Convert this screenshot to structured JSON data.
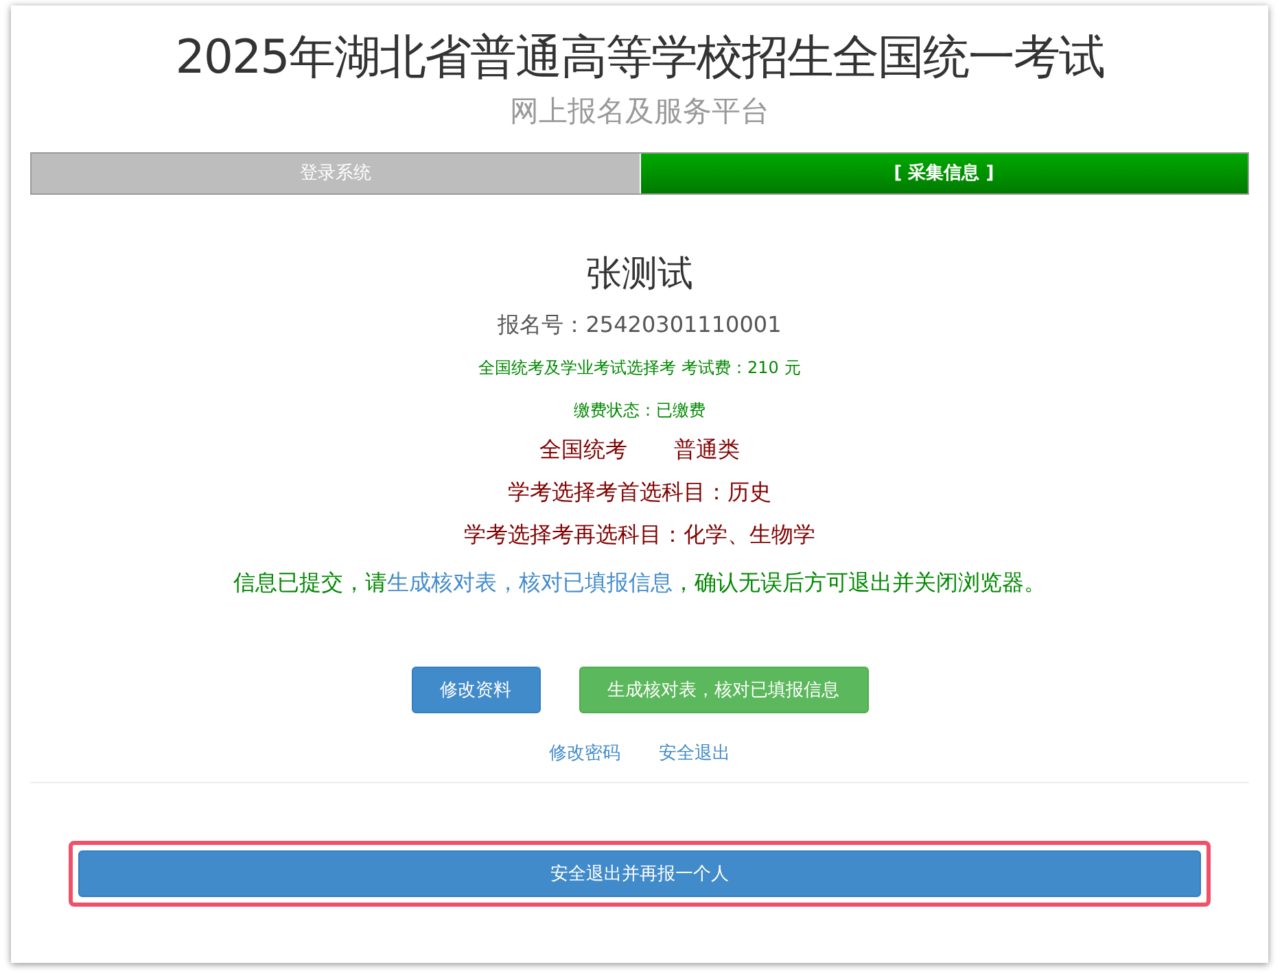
{
  "header": {
    "title": "2025年湖北省普通高等学校招生全国统一考试",
    "subtitle": "网上报名及服务平台"
  },
  "steps": [
    {
      "label": "登录系统",
      "selected": false
    },
    {
      "label": "[ 采集信息 ]",
      "selected": true
    }
  ],
  "candidate": {
    "name": "张测试",
    "reg_number": "报名号：25420301110001",
    "fee": "全国统考及学业考试选择考 考试费：210 元",
    "payment_status": "缴费状态：已缴费",
    "exam_type": "全国统考",
    "category": "普通类",
    "first_subject": "学考选择考首选科目：历史",
    "second_subjects": "学考选择考再选科目：化学、生物学"
  },
  "notice": [
    {
      "kind": "text",
      "text": "信息已提交，请"
    },
    {
      "kind": "link",
      "text": "生成核对表，核对已填报信息"
    },
    {
      "kind": "text",
      "text": "，确认无误后方可退出并关闭浏览器。"
    }
  ],
  "buttons": [
    {
      "label": "修改资料",
      "kind": "primary"
    },
    {
      "label": "生成核对表，核对已填报信息",
      "kind": "success"
    }
  ],
  "links": [
    "修改密码",
    "安全退出"
  ],
  "bottom_button": {
    "label": "安全退出并再报一个人",
    "highlighted": true
  }
}
